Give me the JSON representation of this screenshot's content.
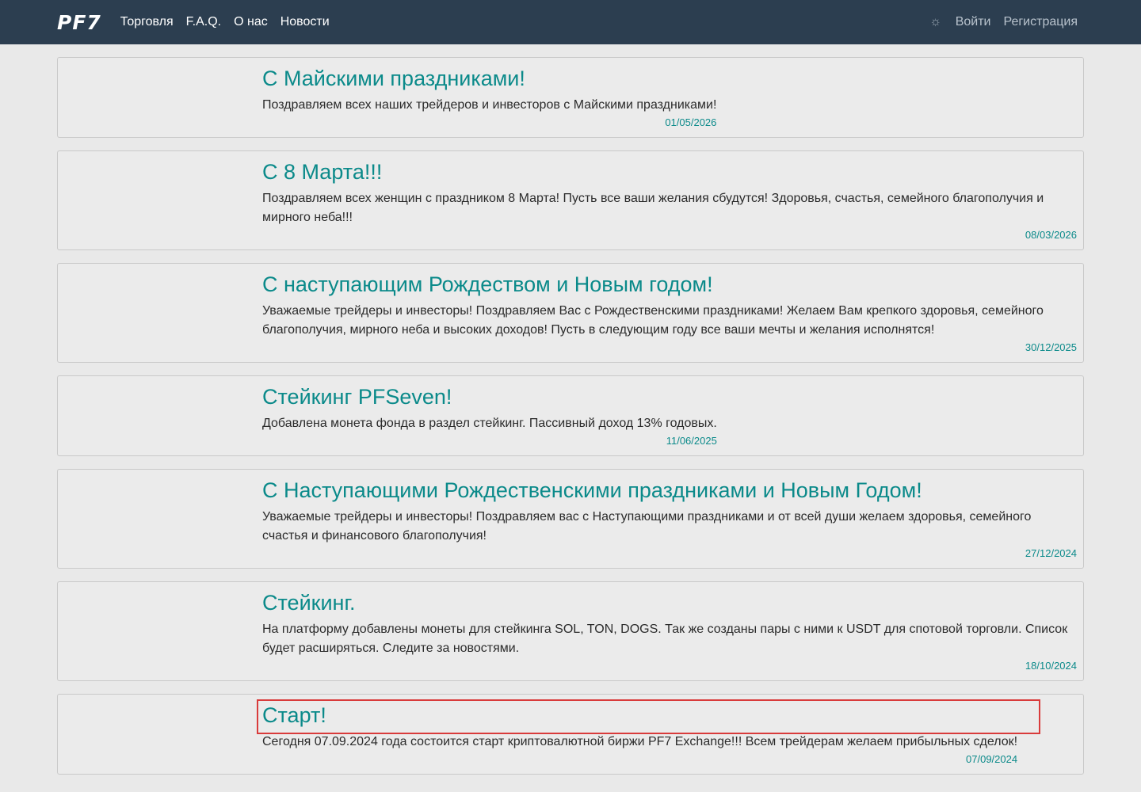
{
  "header": {
    "logo": "PF7",
    "nav": [
      "Торговля",
      "F.A.Q.",
      "О нас",
      "Новости"
    ],
    "theme_icon": "sun-icon",
    "login": "Войти",
    "register": "Регистрация"
  },
  "news": [
    {
      "title": "С Майскими праздниками!",
      "body": "Поздравляем всех наших трейдеров и инвесторов с Майскими праздниками!",
      "date": "01/05/2026"
    },
    {
      "title": "С 8 Марта!!!",
      "body": "Поздравляем всех женщин с праздником 8 Марта! Пусть все ваши желания сбудутся! Здоровья, счастья, семейного благополучия и мирного неба!!!",
      "date": "08/03/2026"
    },
    {
      "title": "С наступающим Рождеством и Новым годом!",
      "body": "Уважаемые трейдеры и инвесторы! Поздравляем Вас с Рождественскими праздниками! Желаем Вам крепкого здоровья, семейного благополучия, мирного неба и высоких доходов! Пусть в следующим году все ваши мечты и желания исполнятся!",
      "date": "30/12/2025"
    },
    {
      "title": "Стейкинг PFSeven!",
      "body": "Добавлена монета фонда в раздел стейкинг. Пассивный доход 13% годовых.",
      "date": "11/06/2025"
    },
    {
      "title": "С Наступающими Рождественскими праздниками и Новым Годом!",
      "body": "Уважаемые трейдеры и инвесторы! Поздравляем вас с Наступающими праздниками и от всей души желаем здоровья, семейного счастья и финансового благополучия!",
      "date": "27/12/2024"
    },
    {
      "title": "Стейкинг.",
      "body": "На платформу добавлены монеты для стейкинга SOL, TON, DOGS. Так же созданы пары с ними к USDT для спотовой торговли. Список будет расширяться. Следите за новостями.",
      "date": "18/10/2024"
    },
    {
      "title": "Старт!",
      "body": "Сегодня 07.09.2024 года состоится старт криптовалютной биржи PF7 Exchange!!! Всем трейдерам желаем прибыльных сделок!",
      "date": "07/09/2024"
    }
  ],
  "colors": {
    "header_bg": "#2c3e50",
    "accent": "#0b8a8a",
    "page_bg": "#e9e9e9",
    "highlight": "#d93b3b"
  }
}
